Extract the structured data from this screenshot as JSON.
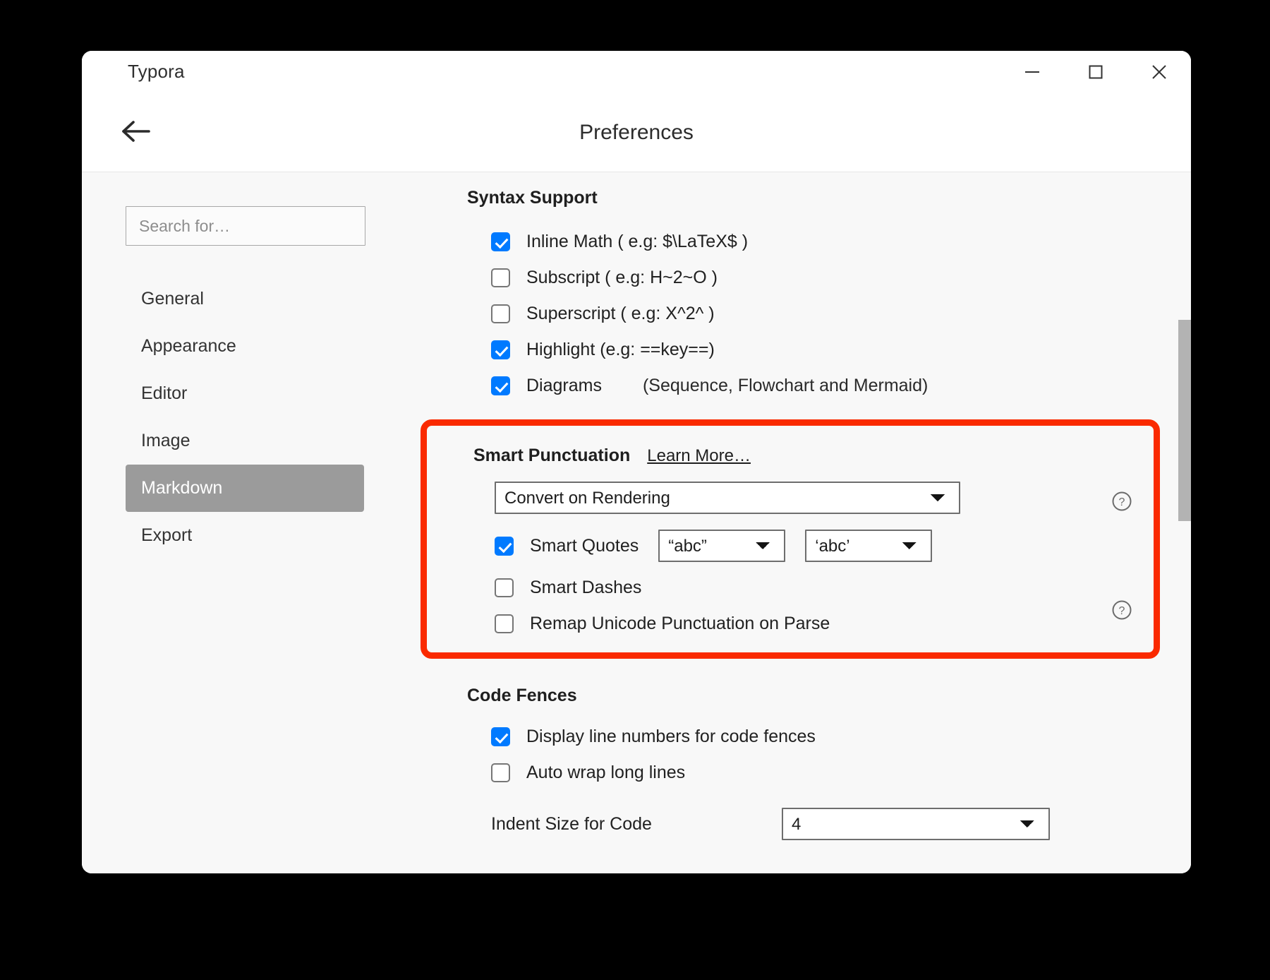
{
  "window": {
    "app_title": "Typora",
    "controls": {
      "minimize": "minimize-icon",
      "maximize": "maximize-icon",
      "close": "close-icon"
    }
  },
  "header": {
    "back_icon": "arrow-left-icon",
    "title": "Preferences"
  },
  "sidebar": {
    "search": {
      "value": "",
      "placeholder": "Search for…"
    },
    "items": [
      {
        "label": "General",
        "active": false
      },
      {
        "label": "Appearance",
        "active": false
      },
      {
        "label": "Editor",
        "active": false
      },
      {
        "label": "Image",
        "active": false
      },
      {
        "label": "Markdown",
        "active": true
      },
      {
        "label": "Export",
        "active": false
      }
    ]
  },
  "main": {
    "syntax_support": {
      "title": "Syntax Support",
      "options": [
        {
          "label": "Inline Math ( e.g: $\\LaTeX$ )",
          "checked": true,
          "note": ""
        },
        {
          "label": "Subscript ( e.g: H~2~O )",
          "checked": false,
          "note": ""
        },
        {
          "label": "Superscript ( e.g: X^2^ )",
          "checked": false,
          "note": ""
        },
        {
          "label": "Highlight (e.g: ==key==)",
          "checked": true,
          "note": ""
        },
        {
          "label": "Diagrams",
          "checked": true,
          "note": "(Sequence, Flowchart and Mermaid)"
        }
      ]
    },
    "smart_punctuation": {
      "title": "Smart Punctuation",
      "learn_more": "Learn More…",
      "highlight_color": "#fa2a00",
      "mode_select": {
        "value": "Convert on Rendering"
      },
      "smart_quotes": {
        "label": "Smart Quotes",
        "checked": true,
        "double_select": {
          "value": "“abc”"
        },
        "single_select": {
          "value": "‘abc’"
        }
      },
      "smart_dashes": {
        "label": "Smart Dashes",
        "checked": false
      },
      "remap": {
        "label": "Remap Unicode Punctuation on Parse",
        "checked": false
      },
      "help_icon": "question-circle-icon"
    },
    "code_fences": {
      "title": "Code Fences",
      "options": [
        {
          "label": "Display line numbers for code fences",
          "checked": true
        },
        {
          "label": "Auto wrap long lines",
          "checked": false
        }
      ],
      "indent": {
        "label": "Indent Size for Code",
        "select": {
          "value": "4"
        }
      }
    }
  },
  "colors": {
    "accent_checkbox": "#007aff",
    "highlight_stroke": "#fa2a00",
    "sidebar_active": "#9b9b9b",
    "scrollbar": "#b3b3b3"
  }
}
